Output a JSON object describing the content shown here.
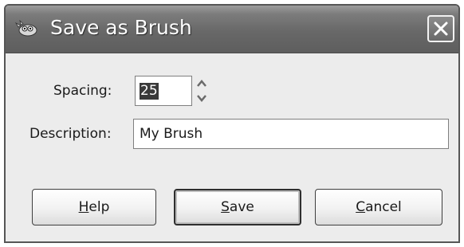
{
  "window": {
    "title": "Save as Brush",
    "icon": "gimp-wilber-icon",
    "close_icon": "close-icon"
  },
  "form": {
    "spacing_label": "Spacing:",
    "spacing_value": "25",
    "description_label": "Description:",
    "description_value": "My Brush"
  },
  "buttons": {
    "help": {
      "mnemonic": "H",
      "rest": "elp"
    },
    "save": {
      "mnemonic": "S",
      "rest": "ave"
    },
    "cancel": {
      "mnemonic": "C",
      "rest": "ancel"
    }
  },
  "colors": {
    "titlebar": "#6a6a6a",
    "dialog_bg": "#ececec",
    "selection": "#3a3a3a"
  }
}
